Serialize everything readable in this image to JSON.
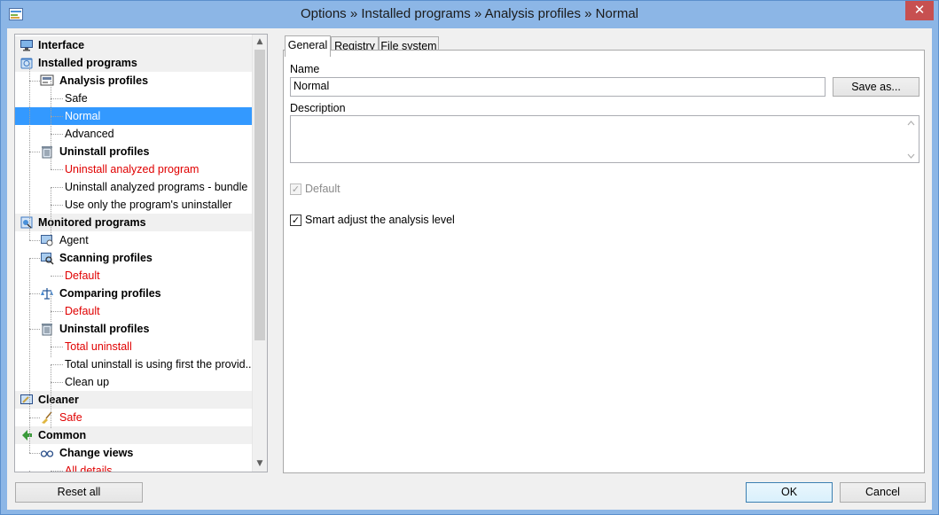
{
  "window": {
    "title": "Options » Installed programs » Analysis profiles » Normal",
    "close_glyph": "✕"
  },
  "tree": {
    "scroll_up": "▲",
    "scroll_down": "▼",
    "items": [
      {
        "label": "Interface",
        "bold": true,
        "level": 0,
        "icon": "monitor-icon"
      },
      {
        "label": "Installed programs",
        "bold": true,
        "level": 0,
        "icon": "installed-programs-icon"
      },
      {
        "label": "Analysis profiles",
        "bold": true,
        "level": 1,
        "icon": "analysis-profiles-icon"
      },
      {
        "label": "Safe",
        "level": 2
      },
      {
        "label": "Normal",
        "level": 2,
        "selected": true
      },
      {
        "label": "Advanced",
        "level": 2
      },
      {
        "label": "Uninstall profiles",
        "bold": true,
        "level": 1,
        "icon": "trash-bin-icon"
      },
      {
        "label": "Uninstall analyzed program",
        "level": 2,
        "red": true
      },
      {
        "label": "Uninstall analyzed programs - bundle",
        "level": 2
      },
      {
        "label": "Use only the program's uninstaller",
        "level": 2
      },
      {
        "label": "Monitored programs",
        "bold": true,
        "level": 0,
        "icon": "monitored-programs-icon"
      },
      {
        "label": "Agent",
        "level": 1,
        "icon": "agent-icon"
      },
      {
        "label": "Scanning profiles",
        "bold": true,
        "level": 1,
        "icon": "scanning-icon"
      },
      {
        "label": "Default",
        "level": 2,
        "red": true
      },
      {
        "label": "Comparing profiles",
        "bold": true,
        "level": 1,
        "icon": "balance-scale-icon"
      },
      {
        "label": "Default",
        "level": 2,
        "red": true
      },
      {
        "label": "Uninstall profiles",
        "bold": true,
        "level": 1,
        "icon": "trash-bin-icon"
      },
      {
        "label": "Total uninstall",
        "level": 2,
        "red": true
      },
      {
        "label": "Total uninstall is using first the provid...",
        "level": 2
      },
      {
        "label": "Clean up",
        "level": 2
      },
      {
        "label": "Cleaner",
        "bold": true,
        "level": 0,
        "icon": "cleaner-icon"
      },
      {
        "label": "Safe",
        "level": 1,
        "red": true,
        "icon": "broom-icon"
      },
      {
        "label": "Common",
        "bold": true,
        "level": 0,
        "icon": "green-arrows-icon"
      },
      {
        "label": "Change views",
        "bold": true,
        "level": 1,
        "icon": "glasses-icon"
      },
      {
        "label": "All details",
        "level": 2,
        "red": true
      }
    ]
  },
  "tabs": [
    {
      "label": "General",
      "active": true
    },
    {
      "label": "Registry"
    },
    {
      "label": "File system"
    }
  ],
  "general": {
    "name_label": "Name",
    "name_value": "Normal",
    "save_as_label": "Save as...",
    "description_label": "Description",
    "description_value": "",
    "default_label": "Default",
    "default_checked": true,
    "default_enabled": false,
    "smart_adjust_label": "Smart adjust the analysis level",
    "smart_adjust_checked": true
  },
  "footer": {
    "reset_all_label": "Reset all",
    "ok_label": "OK",
    "cancel_label": "Cancel"
  },
  "colors": {
    "selection": "#3399ff",
    "red_item": "#e00000",
    "title_bar": "#8cb6e6",
    "close_button": "#c75050"
  }
}
